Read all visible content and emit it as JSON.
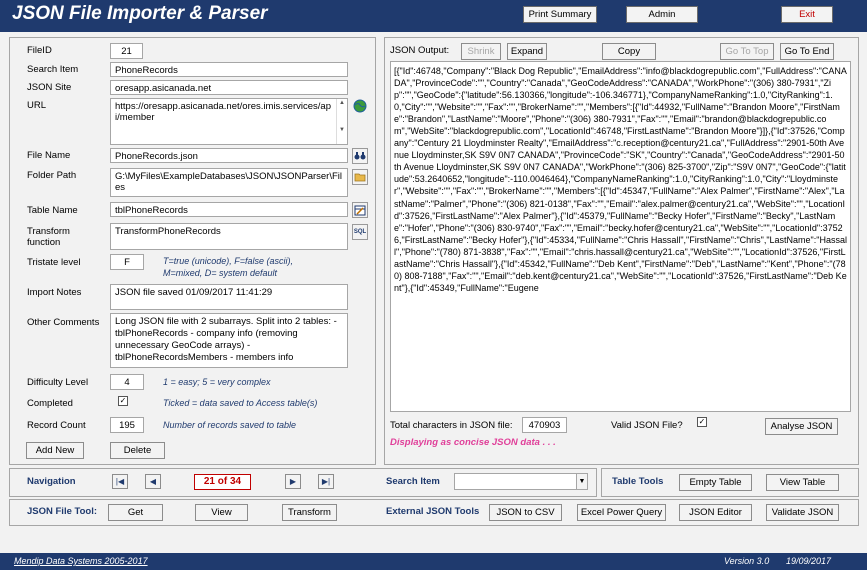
{
  "app": {
    "title": "JSON File Importer & Parser",
    "print_label": "Print Summary",
    "admin_label": "Admin",
    "exit_label": "Exit"
  },
  "form": {
    "fileid_label": "FileID",
    "fileid_value": "21",
    "search_item_label": "Search Item",
    "search_item_value": "PhoneRecords",
    "json_site_label": "JSON Site",
    "json_site_value": "oresapp.asicanada.net",
    "url_label": "URL",
    "url_value": "https://oresapp.asicanada.net/ores.imis.services/api/member",
    "file_name_label": "File Name",
    "file_name_value": "PhoneRecords.json",
    "folder_path_label": "Folder Path",
    "folder_path_value": "G:\\MyFiles\\ExampleDatabases\\JSON\\JSONParser\\Files",
    "table_name_label": "Table Name",
    "table_name_value": "tblPhoneRecords",
    "transform_label_1": "Transform",
    "transform_label_2": "function",
    "transform_value": "TransformPhoneRecords",
    "tristate_label": "Tristate level",
    "tristate_value": "F",
    "tristate_note_1": "T=true (unicode), F=false (ascii),",
    "tristate_note_2": "M=mixed, D= system default",
    "import_notes_label": "Import Notes",
    "import_notes_value": "JSON file saved 01/09/2017 11:41:29",
    "other_comments_label": "Other Comments",
    "other_comments_value": "Long JSON file with 2 subarrays. Split into 2 tables: -tblPhoneRecords - company info (removing unnecessary GeoCode arrays) -tblPhoneRecordsMembers - members info",
    "difficulty_label": "Difficulty Level",
    "difficulty_value": "4",
    "difficulty_note": "1 = easy; 5 = very complex",
    "completed_label": "Completed",
    "completed_checked": true,
    "completed_note": "Ticked = data saved to Access table(s)",
    "record_count_label": "Record Count",
    "record_count_value": "195",
    "record_count_note": "Number of records saved to table",
    "add_new_label": "Add New",
    "delete_label": "Delete"
  },
  "json_panel": {
    "output_label": "JSON Output:",
    "shrink_label": "Shrink",
    "expand_label": "Expand",
    "copy_label": "Copy",
    "goto_top_label": "Go To Top",
    "goto_end_label": "Go To End",
    "output_text": "[{\"Id\":46748,\"Company\":\"Black Dog Republic\",\"EmailAddress\":\"info@blackdogrepublic.com\",\"FullAddress\":\"CANADA\",\"ProvinceCode\":\"\",\"Country\":\"Canada\",\"GeoCodeAddress\":\"CANADA\",\"WorkPhone\":\"(306) 380-7931\",\"Zip\":\"\",\"GeoCode\":{\"latitude\":56.130366,\"longitude\":-106.346771},\"CompanyNameRanking\":1.0,\"CityRanking\":1.0,\"City\":\"\",\"Website\":\"\",\"Fax\":\"\",\"BrokerName\":\"\",\"Members\":[{\"Id\":44932,\"FullName\":\"Brandon Moore\",\"FirstName\":\"Brandon\",\"LastName\":\"Moore\",\"Phone\":\"(306) 380-7931\",\"Fax\":\"\",\"Email\":\"brandon@blackdogrepublic.com\",\"WebSite\":\"blackdogrepublic.com\",\"LocationId\":46748,\"FirstLastName\":\"Brandon Moore\"}]},{\"Id\":37526,\"Company\":\"Century 21 Lloydminster Realty\",\"EmailAddress\":\"c.reception@century21.ca\",\"FullAddress\":\"2901-50th Avenue Lloydminster,SK S9V 0N7 CANADA\",\"ProvinceCode\":\"SK\",\"Country\":\"Canada\",\"GeoCodeAddress\":\"2901-50th Avenue Lloydminster,SK S9V 0N7 CANADA\",\"WorkPhone\":\"(306) 825-3700\",\"Zip\":\"S9V 0N7\",\"GeoCode\":{\"latitude\":53.2640652,\"longitude\":-110.0046464},\"CompanyNameRanking\":1.0,\"CityRanking\":1.0,\"City\":\"Lloydminster\",\"Website\":\"\",\"Fax\":\"\",\"BrokerName\":\"\",\"Members\":[{\"Id\":45347,\"FullName\":\"Alex Palmer\",\"FirstName\":\"Alex\",\"LastName\":\"Palmer\",\"Phone\":\"(306) 821-0138\",\"Fax\":\"\",\"Email\":\"alex.palmer@century21.ca\",\"WebSite\":\"\",\"LocationId\":37526,\"FirstLastName\":\"Alex Palmer\"},{\"Id\":45379,\"FullName\":\"Becky Hofer\",\"FirstName\":\"Becky\",\"LastName\":\"Hofer\",\"Phone\":\"(306) 830-9740\",\"Fax\":\"\",\"Email\":\"becky.hofer@century21.ca\",\"WebSite\":\"\",\"LocationId\":37526,\"FirstLastName\":\"Becky Hofer\"},{\"Id\":45334,\"FullName\":\"Chris Hassall\",\"FirstName\":\"Chris\",\"LastName\":\"Hassall\",\"Phone\":\"(780) 871-3838\",\"Fax\":\"\",\"Email\":\"chris.hassall@century21.ca\",\"WebSite\":\"\",\"LocationId\":37526,\"FirstLastName\":\"Chris Hassall\"},{\"Id\":45342,\"FullName\":\"Deb Kent\",\"FirstName\":\"Deb\",\"LastName\":\"Kent\",\"Phone\":\"(780) 808-7188\",\"Fax\":\"\",\"Email\":\"deb.kent@century21.ca\",\"WebSite\":\"\",\"LocationId\":37526,\"FirstLastName\":\"Deb Kent\"},{\"Id\":45349,\"FullName\":\"Eugene",
    "total_chars_label": "Total characters in JSON file:",
    "total_chars_value": "470903",
    "valid_json_label": "Valid JSON File?",
    "valid_json_checked": true,
    "analyse_label": "Analyse JSON",
    "status_text": "Displaying as concise JSON data . . ."
  },
  "navigation": {
    "label": "Navigation",
    "record_position": "21 of 34",
    "search_item_label": "Search Item",
    "search_item_value": ""
  },
  "table_tools": {
    "label": "Table Tools",
    "empty_label": "Empty Table",
    "view_label": "View Table"
  },
  "file_tool": {
    "label": "JSON File Tool:",
    "get_label": "Get",
    "view_label": "View",
    "transform_label": "Transform"
  },
  "external_tools": {
    "label": "External JSON Tools",
    "csv_label": "JSON to CSV",
    "excel_label": "Excel Power Query",
    "editor_label": "JSON Editor",
    "validate_label": "Validate JSON"
  },
  "footer": {
    "company": "Mendip Data Systems 2005-2017",
    "version": "Version 3.0",
    "date": "19/09/2017"
  },
  "colors": {
    "header_bg": "#1f3a6e",
    "exit_text": "#c00000",
    "note_text": "#1f3a6e",
    "status_text": "#e0409a",
    "record_position_text": "#c00000"
  },
  "icons": {
    "url": "globe-icon",
    "file_name": "binoculars-icon",
    "folder_path": "folder-icon",
    "table_name": "table-edit-icon",
    "transform": "sql-icon",
    "nav_first": "first-record-icon",
    "nav_prev": "previous-record-icon",
    "nav_next": "next-record-icon",
    "nav_last": "last-record-icon"
  }
}
